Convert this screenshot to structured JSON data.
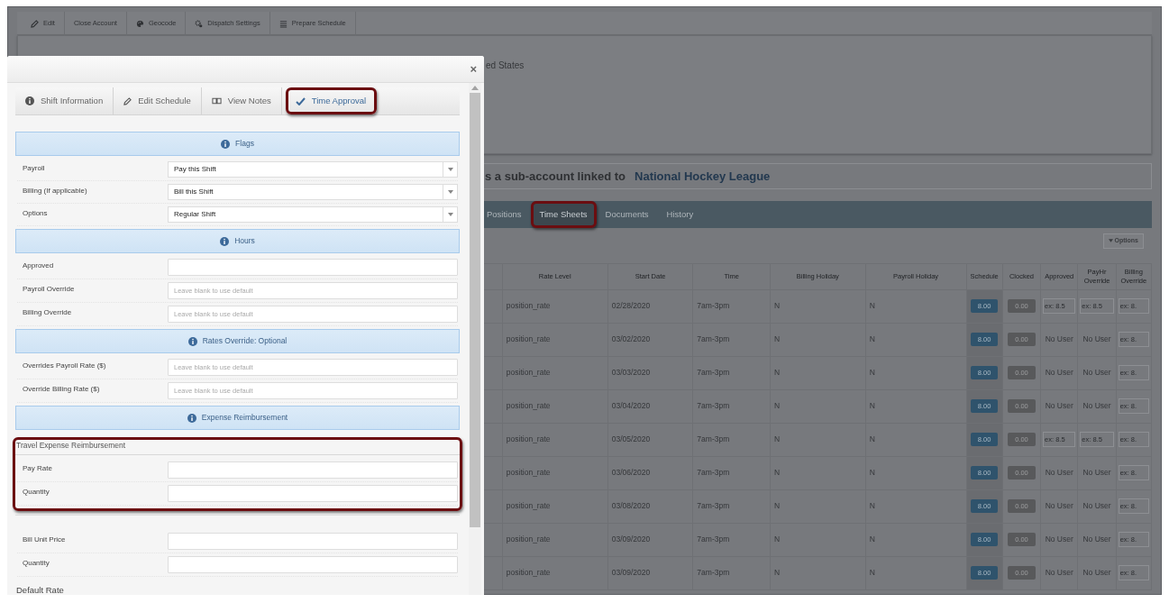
{
  "toolbar": [
    {
      "label": "Edit",
      "kind": "edit"
    },
    {
      "label": "Close Account",
      "kind": "plain"
    },
    {
      "label": "Geocode",
      "kind": "geocode"
    },
    {
      "label": "Dispatch Settings",
      "kind": "dispatch"
    },
    {
      "label": "Prepare Schedule",
      "kind": "schedule"
    }
  ],
  "account": {
    "address_fragment": "ed States",
    "linked_text": "s a sub-account linked to",
    "linked_account": "National Hockey League"
  },
  "account_tabs": [
    {
      "label": "Positions",
      "selected": false,
      "highlighted": false
    },
    {
      "label": "Time Sheets",
      "selected": true,
      "highlighted": true
    },
    {
      "label": "Documents",
      "selected": false,
      "highlighted": false
    },
    {
      "label": "History",
      "selected": false,
      "highlighted": false
    }
  ],
  "options_button": "Options",
  "table": {
    "columns": [
      "Rate Level",
      "Start Date",
      "Time",
      "Billing Holiday",
      "Payroll Holiday",
      "Schedule",
      "Clocked",
      "Approved",
      "PayHr Override",
      "Billing Override"
    ],
    "rows": [
      {
        "rate_level": "position_rate",
        "start_date": "02/28/2020",
        "time": "7am-3pm",
        "billing_holiday": "N",
        "payroll_holiday": "N",
        "schedule": "8.00",
        "clocked": "0.00",
        "approved": {
          "kind": "input",
          "placeholder": "ex: 8.5"
        },
        "payhr_override": {
          "kind": "input",
          "placeholder": "ex: 8.5"
        },
        "billing_override": {
          "kind": "input",
          "placeholder": "ex: 8."
        }
      },
      {
        "rate_level": "position_rate",
        "start_date": "03/02/2020",
        "time": "7am-3pm",
        "billing_holiday": "N",
        "payroll_holiday": "N",
        "schedule": "8.00",
        "clocked": "0.00",
        "approved": {
          "kind": "text",
          "text": "No User"
        },
        "payhr_override": {
          "kind": "text",
          "text": "No User"
        },
        "billing_override": {
          "kind": "input",
          "placeholder": "ex: 8."
        }
      },
      {
        "rate_level": "position_rate",
        "start_date": "03/03/2020",
        "time": "7am-3pm",
        "billing_holiday": "N",
        "payroll_holiday": "N",
        "schedule": "8.00",
        "clocked": "0.00",
        "approved": {
          "kind": "text",
          "text": "No User"
        },
        "payhr_override": {
          "kind": "text",
          "text": "No User"
        },
        "billing_override": {
          "kind": "input",
          "placeholder": "ex: 8."
        }
      },
      {
        "rate_level": "position_rate",
        "start_date": "03/04/2020",
        "time": "7am-3pm",
        "billing_holiday": "N",
        "payroll_holiday": "N",
        "schedule": "8.00",
        "clocked": "0.00",
        "approved": {
          "kind": "text",
          "text": "No User"
        },
        "payhr_override": {
          "kind": "text",
          "text": "No User"
        },
        "billing_override": {
          "kind": "input",
          "placeholder": "ex: 8."
        }
      },
      {
        "rate_level": "position_rate",
        "start_date": "03/05/2020",
        "time": "7am-3pm",
        "billing_holiday": "N",
        "payroll_holiday": "N",
        "schedule": "8.00",
        "clocked": "0.00",
        "approved": {
          "kind": "input",
          "placeholder": "ex: 8.5"
        },
        "payhr_override": {
          "kind": "input",
          "placeholder": "ex: 8.5"
        },
        "billing_override": {
          "kind": "input",
          "placeholder": "ex: 8."
        }
      },
      {
        "rate_level": "position_rate",
        "start_date": "03/06/2020",
        "time": "7am-3pm",
        "billing_holiday": "N",
        "payroll_holiday": "N",
        "schedule": "8.00",
        "clocked": "0.00",
        "approved": {
          "kind": "text",
          "text": "No User"
        },
        "payhr_override": {
          "kind": "text",
          "text": "No User"
        },
        "billing_override": {
          "kind": "input",
          "placeholder": "ex: 8."
        }
      },
      {
        "rate_level": "position_rate",
        "start_date": "03/08/2020",
        "time": "7am-3pm",
        "billing_holiday": "N",
        "payroll_holiday": "N",
        "schedule": "8.00",
        "clocked": "0.00",
        "approved": {
          "kind": "text",
          "text": "No User"
        },
        "payhr_override": {
          "kind": "text",
          "text": "No User"
        },
        "billing_override": {
          "kind": "input",
          "placeholder": "ex: 8."
        }
      },
      {
        "rate_level": "position_rate",
        "start_date": "03/09/2020",
        "time": "7am-3pm",
        "billing_holiday": "N",
        "payroll_holiday": "N",
        "schedule": "8.00",
        "clocked": "0.00",
        "approved": {
          "kind": "text",
          "text": "No User"
        },
        "payhr_override": {
          "kind": "text",
          "text": "No User"
        },
        "billing_override": {
          "kind": "input",
          "placeholder": "ex: 8."
        }
      },
      {
        "rate_level": "position_rate",
        "start_date": "03/09/2020",
        "time": "7am-3pm",
        "billing_holiday": "N",
        "payroll_holiday": "N",
        "schedule": "8.00",
        "clocked": "0.00",
        "approved": {
          "kind": "text",
          "text": "No User"
        },
        "payhr_override": {
          "kind": "text",
          "text": "No User"
        },
        "billing_override": {
          "kind": "input",
          "placeholder": "ex: 8."
        }
      }
    ]
  },
  "modal": {
    "close": "×",
    "tabs": [
      {
        "label": "Shift Information",
        "kind": "info",
        "selected": false,
        "highlighted": false
      },
      {
        "label": "Edit Schedule",
        "kind": "edit",
        "selected": false,
        "highlighted": false
      },
      {
        "label": "View Notes",
        "kind": "notes",
        "selected": false,
        "highlighted": false
      },
      {
        "label": "Time Approval",
        "kind": "check",
        "selected": true,
        "highlighted": true
      }
    ],
    "sections": [
      {
        "kind": "header",
        "title": "Flags"
      },
      {
        "kind": "select",
        "label": "Payroll",
        "value": "Pay this Shift"
      },
      {
        "kind": "select",
        "label": "Billing (If applicable)",
        "value": "Bill this Shift"
      },
      {
        "kind": "select",
        "label": "Options",
        "value": "Regular Shift"
      },
      {
        "kind": "header",
        "title": "Hours"
      },
      {
        "kind": "input",
        "label": "Approved"
      },
      {
        "kind": "input",
        "label": "Payroll Override",
        "placeholder": "Leave blank to use default"
      },
      {
        "kind": "input",
        "label": "Billing Override",
        "placeholder": "Leave blank to use default"
      },
      {
        "kind": "header",
        "title": "Rates Override: Optional"
      },
      {
        "kind": "input",
        "label": "Overrides Payroll Rate ($)",
        "placeholder": "Leave blank to use default"
      },
      {
        "kind": "input",
        "label": "Override Billing Rate ($)",
        "placeholder": "Leave blank to use default"
      },
      {
        "kind": "header",
        "title": "Expense Reimbursement"
      },
      {
        "kind": "group",
        "title": "Travel Expense Reimbursement",
        "highlighted": true,
        "children": [
          {
            "kind": "input",
            "label": "Pay Rate"
          },
          {
            "kind": "input",
            "label": "Quantity"
          }
        ]
      },
      {
        "kind": "input",
        "label": "Bill Unit Price"
      },
      {
        "kind": "input",
        "label": "Quantity"
      },
      {
        "kind": "subheading",
        "title": "Default Rate"
      }
    ]
  }
}
